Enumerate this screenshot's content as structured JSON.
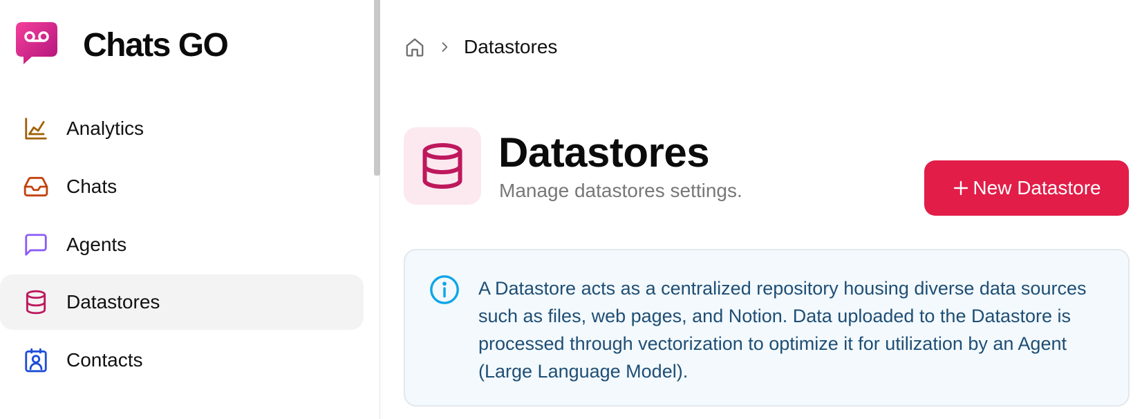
{
  "brand": {
    "name": "Chats GO",
    "logo_icon": "voicemail-chat-bubble-icon",
    "accent": "#e4368f"
  },
  "sidebar": {
    "items": [
      {
        "label": "Analytics",
        "icon": "chart-line-icon",
        "color": "#a16207",
        "active": false
      },
      {
        "label": "Chats",
        "icon": "inbox-icon",
        "color": "#c2410c",
        "active": false
      },
      {
        "label": "Agents",
        "icon": "message-square-icon",
        "color": "#8b5cf6",
        "active": false
      },
      {
        "label": "Datastores",
        "icon": "database-icon",
        "color": "#be185d",
        "active": true
      },
      {
        "label": "Contacts",
        "icon": "contact-card-icon",
        "color": "#1d4ed8",
        "active": false
      }
    ]
  },
  "breadcrumb": {
    "home_icon": "home-icon",
    "separator_icon": "chevron-right-icon",
    "current": "Datastores"
  },
  "header": {
    "title": "Datastores",
    "subtitle": "Manage datastores settings.",
    "icon": "database-icon",
    "icon_color": "#be185d"
  },
  "actions": {
    "new_label": "New Datastore",
    "new_icon": "plus-icon",
    "new_color": "#e11d48"
  },
  "info": {
    "icon": "info-circle-icon",
    "text": "A Datastore acts as a centralized repository housing diverse data sources such as files, web pages, and Notion. Data uploaded to the Datastore is processed through vectorization to optimize it for utilization by an Agent (Large Language Model)."
  }
}
